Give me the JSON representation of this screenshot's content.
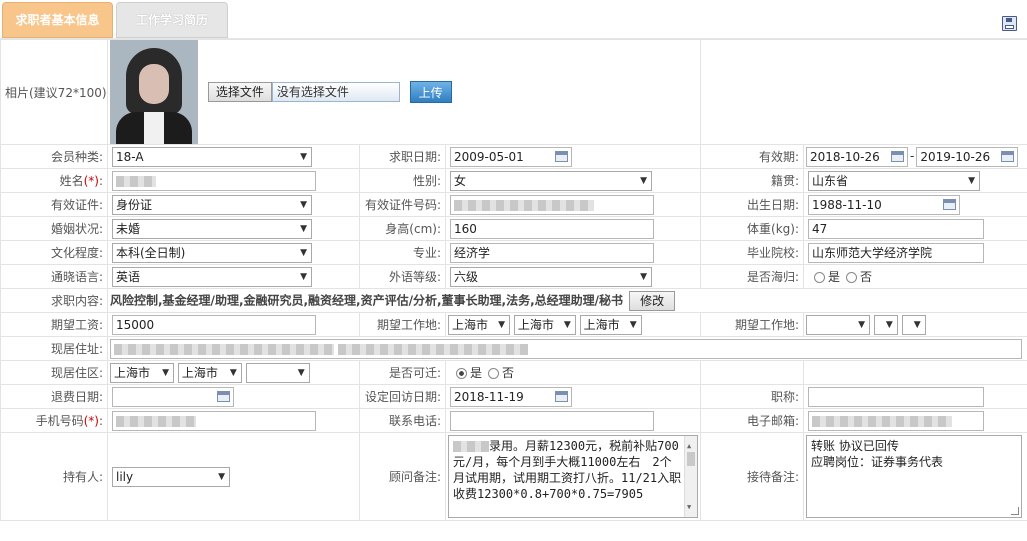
{
  "tabs": [
    {
      "label": "求职者基本信息",
      "active": true
    },
    {
      "label": "工作学习简历",
      "active": false
    }
  ],
  "icons": {
    "save": "save-disk-icon",
    "calendar": "calendar-icon"
  },
  "colors": {
    "active_tab": "#f8c58b",
    "inactive_tab": "#e6e6e6",
    "upload_button": "#2f7fc1"
  },
  "photo": {
    "label": "相片(建议72*100):",
    "choose_file_button": "选择文件",
    "file_status": "没有选择文件",
    "upload_button": "上传"
  },
  "fields": {
    "member_type": {
      "label": "会员种类:",
      "value": "18-A"
    },
    "apply_date": {
      "label": "求职日期:",
      "value": "2009-05-01"
    },
    "valid_period": {
      "label": "有效期:",
      "from": "2018-10-26",
      "sep": "-",
      "to": "2019-10-26"
    },
    "name": {
      "label": "姓名",
      "req": "(*)",
      "colon": ":"
    },
    "gender": {
      "label": "性别:",
      "value": "女"
    },
    "native_place": {
      "label": "籍贯:",
      "value": "山东省"
    },
    "id_type": {
      "label": "有效证件:",
      "value": "身份证"
    },
    "id_number": {
      "label": "有效证件号码:"
    },
    "birth_date": {
      "label": "出生日期:",
      "value": "1988-11-10"
    },
    "marital": {
      "label": "婚姻状况:",
      "value": "未婚"
    },
    "height": {
      "label": "身高(cm):",
      "value": "160"
    },
    "weight": {
      "label": "体重(kg):",
      "value": "47"
    },
    "education": {
      "label": "文化程度:",
      "value": "本科(全日制)"
    },
    "major": {
      "label": "专业:",
      "value": "经济学"
    },
    "school": {
      "label": "毕业院校:",
      "value": "山东师范大学经济学院"
    },
    "language": {
      "label": "通晓语言:",
      "value": "英语"
    },
    "language_level": {
      "label": "外语等级:",
      "value": "六级"
    },
    "returnee": {
      "label": "是否海归:",
      "yes": "是",
      "no": "否",
      "selected": "none"
    },
    "job_content": {
      "label": "求职内容:",
      "value": "风险控制,基金经理/助理,金融研究员,融资经理,资产评估/分析,董事长助理,法务,总经理助理/秘书",
      "edit_button": "修改"
    },
    "expected_salary": {
      "label": "期望工资:",
      "value": "15000"
    },
    "expected_location": {
      "label": "期望工作地:",
      "province": "上海市",
      "city": "上海市",
      "district": "上海市"
    },
    "expected_location2": {
      "label": "期望工作地:",
      "province": "",
      "city": "",
      "district": ""
    },
    "current_address": {
      "label": "现居住址:"
    },
    "current_area": {
      "label": "现居住区:",
      "province": "上海市",
      "city": "上海市",
      "district": ""
    },
    "relocate": {
      "label": "是否可迁:",
      "yes": "是",
      "no": "否",
      "selected": "yes"
    },
    "refund_date": {
      "label": "退费日期:",
      "value": ""
    },
    "revisit_date": {
      "label": "设定回访日期:",
      "value": "2018-11-19"
    },
    "title": {
      "label": "职称:",
      "value": ""
    },
    "mobile": {
      "label": "手机号码",
      "req": "(*)",
      "colon": ":"
    },
    "phone": {
      "label": "联系电话:",
      "value": ""
    },
    "email": {
      "label": "电子邮箱:"
    },
    "holder": {
      "label": "持有人:",
      "value": "lily"
    },
    "consultant_note": {
      "label": "顾问备注:",
      "value": "录用。月薪12300元，税前补贴700元/月，每个月到手大概11000左右　2个月试用期，试用期工资打八折。11/21入职收费12300*0.8+700*0.75=7905"
    },
    "reception_note": {
      "label": "接待备注:",
      "line1": "转账 协议已回传",
      "line2": "应聘岗位：证券事务代表"
    }
  }
}
